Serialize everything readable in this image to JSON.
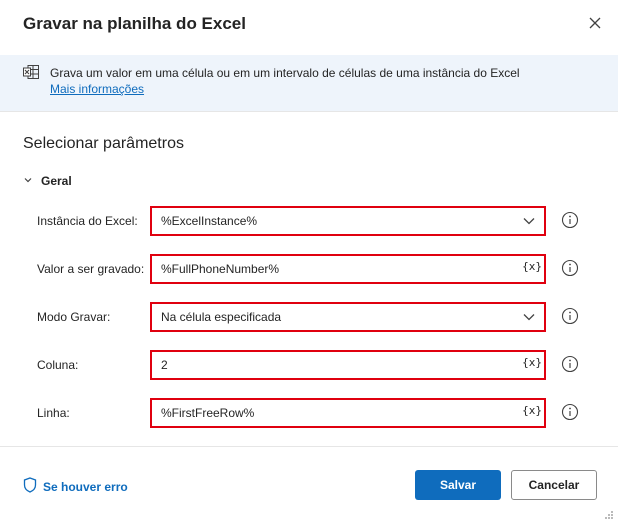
{
  "dialog": {
    "title": "Gravar na planilha do Excel"
  },
  "info": {
    "description": "Grava um valor em uma célula ou em um intervalo de células de uma instância do Excel",
    "more_link": "Mais informações",
    "icon": "excel-icon"
  },
  "section": {
    "title": "Selecionar parâmetros",
    "group": "Geral"
  },
  "fields": [
    {
      "label": "Instância do Excel:",
      "value": "%ExcelInstance%",
      "kind": "dropdown"
    },
    {
      "label": "Valor a ser gravado:",
      "value": "%FullPhoneNumber%",
      "kind": "text",
      "var_button": "{x}"
    },
    {
      "label": "Modo Gravar:",
      "value": "Na célula especificada",
      "kind": "dropdown"
    },
    {
      "label": "Coluna:",
      "value": "2",
      "kind": "text",
      "var_button": "{x}"
    },
    {
      "label": "Linha:",
      "value": "%FirstFreeRow%",
      "kind": "text",
      "var_button": "{x}"
    }
  ],
  "footer": {
    "on_error": "Se houver erro",
    "save": "Salvar",
    "cancel": "Cancelar"
  },
  "colors": {
    "accent": "#0f6cbd",
    "highlight_border": "#e0000f",
    "info_bg": "#eef4fb"
  }
}
